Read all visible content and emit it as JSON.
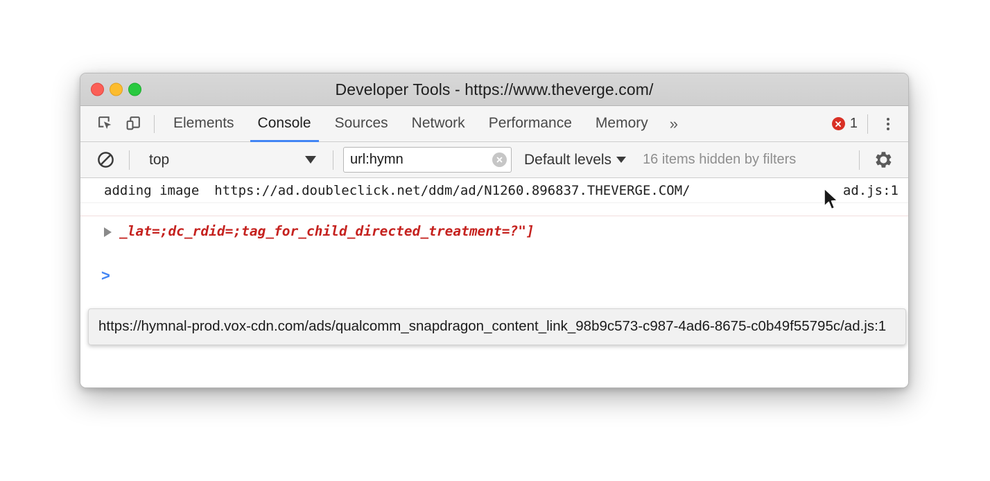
{
  "window": {
    "title": "Developer Tools - https://www.theverge.com/",
    "traffic_lights": {
      "close": "close-button",
      "minimize": "minimize-button",
      "maximize": "maximize-button"
    }
  },
  "tabbar": {
    "inspect_icon": "inspect-element-icon",
    "device_icon": "device-toolbar-icon",
    "tabs": [
      {
        "label": "Elements",
        "active": false
      },
      {
        "label": "Console",
        "active": true
      },
      {
        "label": "Sources",
        "active": false
      },
      {
        "label": "Network",
        "active": false
      },
      {
        "label": "Performance",
        "active": false
      },
      {
        "label": "Memory",
        "active": false
      }
    ],
    "overflow_label": "»",
    "error_count": "1",
    "error_icon": "error-circle-icon",
    "menu_icon": "more-options-icon",
    "error_color": "#d93025",
    "active_tab_underline_color": "#4285f4"
  },
  "filterbar": {
    "clear_console_icon": "clear-console-icon",
    "context": {
      "label": "top",
      "caret": "▼"
    },
    "filter": {
      "value": "url:hymn",
      "placeholder": "Filter",
      "clear_icon": "clear-filter-icon"
    },
    "levels": {
      "label": "Default levels",
      "caret": "▼"
    },
    "hidden_message": "16 items hidden by filters",
    "settings_icon": "settings-gear-icon"
  },
  "console": {
    "messages": [
      {
        "text": "adding image",
        "url": "https://ad.doubleclick.net/ddm/ad/N1260.896837.THEVERGE.COM/",
        "source": "ad.js:1"
      }
    ],
    "error_row": {
      "text": "_lat=;dc_rdid=;tag_for_child_directed_treatment=?\"]",
      "expander": "expand-arrow-icon",
      "color": "#c5221f"
    },
    "prompt_caret": ">"
  },
  "tooltip": {
    "text": "https://hymnal-prod.vox-cdn.com/ads/qualcomm_snapdragon_content_link_98b9c573-c987-4ad6-8675-c0b49f55795c/ad.js:1"
  },
  "cursor": {
    "icon": "mouse-pointer-icon"
  }
}
